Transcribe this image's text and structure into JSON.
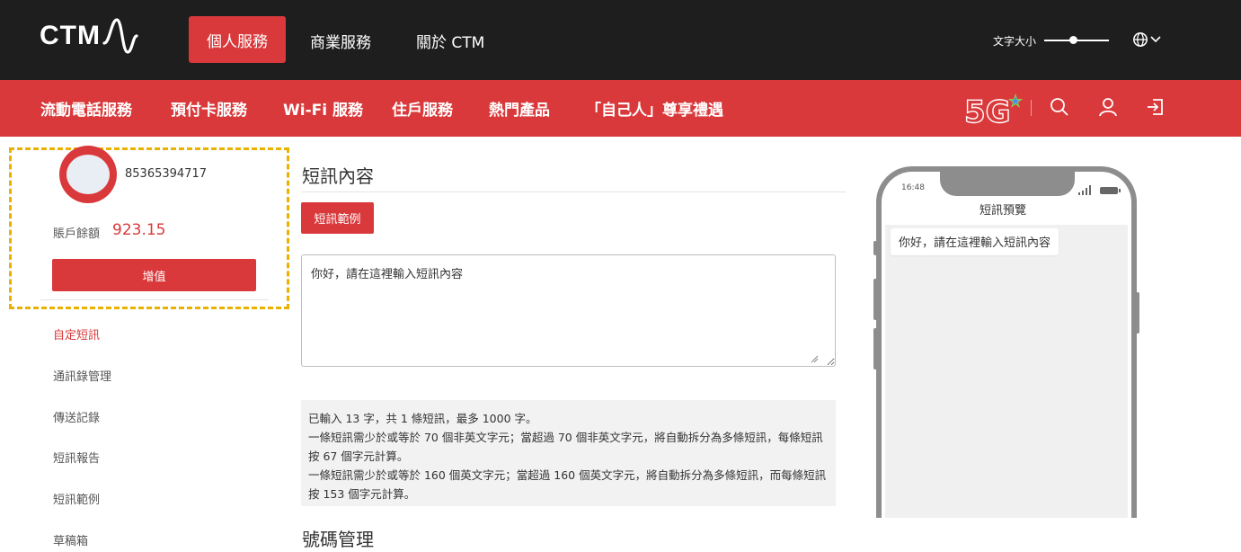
{
  "header": {
    "logo_text": "CTM",
    "tabs": [
      {
        "label": "個人服務",
        "active": true
      },
      {
        "label": "商業服務",
        "active": false
      },
      {
        "label": "關於 CTM",
        "active": false
      }
    ],
    "font_size_label": "文字大小",
    "font_size_level": 0.45,
    "language_icon": "globe-icon"
  },
  "nav": {
    "items": [
      "流動電話服務",
      "預付卡服務",
      "Wi-Fi 服務",
      "住戶服務",
      "熱門產品",
      "「自己人」尊享禮遇"
    ],
    "badge": "5G",
    "icons": [
      "search-icon",
      "user-icon",
      "logout-icon"
    ]
  },
  "account": {
    "phone_number": "85365394717",
    "balance_label": "賬戶餘額",
    "balance_value": "923.15",
    "topup_label": "增值"
  },
  "sidebar": {
    "items": [
      {
        "label": "自定短訊",
        "active": true
      },
      {
        "label": "通訊錄管理",
        "active": false
      },
      {
        "label": "傳送記錄",
        "active": false
      },
      {
        "label": "短訊報告",
        "active": false
      },
      {
        "label": "短訊範例",
        "active": false
      },
      {
        "label": "草稿箱",
        "active": false
      }
    ]
  },
  "content": {
    "sms_section_title": "短訊內容",
    "sample_button": "短訊範例",
    "message_text": "你好，請在這裡輸入短訊內容",
    "info": {
      "line1": "已輸入 13 字，共 1 條短訊，最多 1000 字。",
      "line2": "一條短訊需少於或等於 70 個非英文字元；當超過 70 個非英文字元，將自動拆分為多條短訊，每條短訊按 67 個字元計算。",
      "line3": "一條短訊需少於或等於 160 個英文字元；當超過 160 個英文字元，將自動拆分為多條短訊，而每條短訊按 153 個字元計算。"
    },
    "number_section_title": "號碼管理"
  },
  "preview": {
    "time": "16:48",
    "title": "短訊預覽",
    "bubble_text": "你好，請在這裡輸入短訊內容"
  },
  "colors": {
    "brand_red": "#d9393b",
    "topbar_bg": "#1e1e1e",
    "highlight_dash": "#e9b200"
  }
}
